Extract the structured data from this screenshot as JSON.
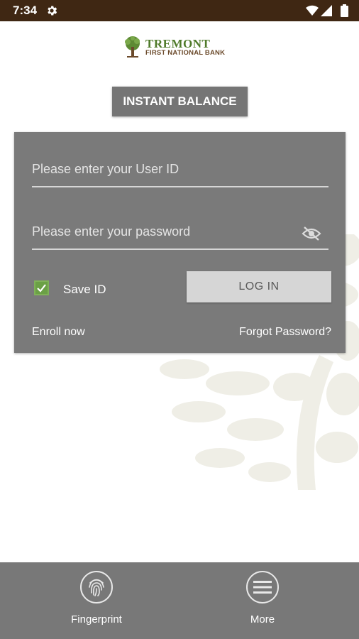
{
  "status_bar": {
    "time": "7:34"
  },
  "logo": {
    "name": "TREMONT",
    "subtitle": "FIRST NATIONAL BANK"
  },
  "instant_balance": {
    "label": "INSTANT BALANCE"
  },
  "login": {
    "user_placeholder": "Please enter your User ID",
    "password_placeholder": "Please enter your password",
    "save_id_label": "Save ID",
    "save_id_checked": true,
    "login_label": "LOG IN",
    "enroll_label": "Enroll now",
    "forgot_label": "Forgot Password?"
  },
  "bottom_nav": {
    "fingerprint_label": "Fingerprint",
    "more_label": "More"
  },
  "colors": {
    "status_bar": "#3f2713",
    "brand_green": "#4f7a2a",
    "brand_brown": "#6b4a2b",
    "checkbox_green": "#6ba046"
  }
}
